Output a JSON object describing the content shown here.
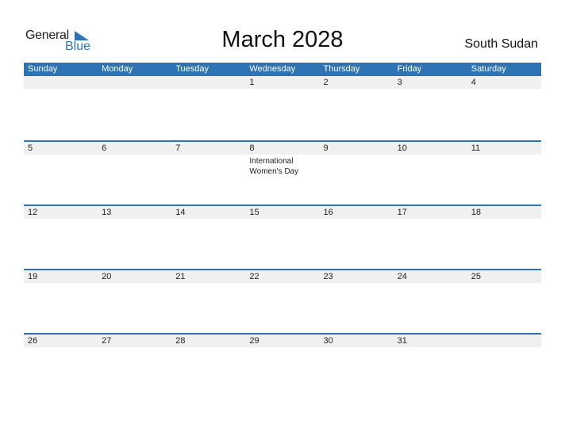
{
  "logo": {
    "line1": "General",
    "line2": "Blue"
  },
  "title": "March 2028",
  "country": "South Sudan",
  "colors": {
    "accent": "#2e74b5",
    "row_bg": "#f0f0f0"
  },
  "weekdays": [
    "Sunday",
    "Monday",
    "Tuesday",
    "Wednesday",
    "Thursday",
    "Friday",
    "Saturday"
  ],
  "weeks": [
    {
      "days": [
        "",
        "",
        "",
        "1",
        "2",
        "3",
        "4"
      ],
      "events": [
        "",
        "",
        "",
        "",
        "",
        "",
        ""
      ]
    },
    {
      "days": [
        "5",
        "6",
        "7",
        "8",
        "9",
        "10",
        "11"
      ],
      "events": [
        "",
        "",
        "",
        "International Women's Day",
        "",
        "",
        ""
      ]
    },
    {
      "days": [
        "12",
        "13",
        "14",
        "15",
        "16",
        "17",
        "18"
      ],
      "events": [
        "",
        "",
        "",
        "",
        "",
        "",
        ""
      ]
    },
    {
      "days": [
        "19",
        "20",
        "21",
        "22",
        "23",
        "24",
        "25"
      ],
      "events": [
        "",
        "",
        "",
        "",
        "",
        "",
        ""
      ]
    },
    {
      "days": [
        "26",
        "27",
        "28",
        "29",
        "30",
        "31",
        ""
      ],
      "events": [
        "",
        "",
        "",
        "",
        "",
        "",
        ""
      ]
    }
  ]
}
